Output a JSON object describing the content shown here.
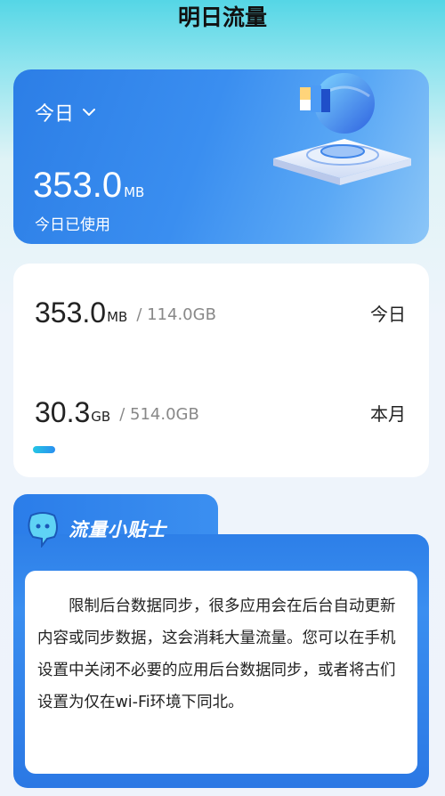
{
  "page": {
    "title": "明日流量"
  },
  "hero": {
    "period_label": "今日",
    "usage_value": "353.0",
    "usage_unit": "MB",
    "usage_caption": "今日已使用"
  },
  "stats": {
    "rows": [
      {
        "value": "353.0",
        "unit": "MB",
        "total": "/ 114.0GB",
        "label": "今日"
      },
      {
        "value": "30.3",
        "unit": "GB",
        "total": "/ 514.0GB",
        "label": "本月"
      }
    ],
    "progress_fraction": 0.06
  },
  "tips": {
    "title": "流量小贴士",
    "text": "限制后台数据同步，很多应用会在后台自动更新内容或同步数据，这会消耗大量流量。您可以在手机设置中关闭不必要的应用后台数据同步，或者将古们设置为仅在wi-Fi环境下同北。"
  },
  "colors": {
    "accent": "#2c7ee6",
    "progress_start": "#24c6e4",
    "progress_end": "#2a8ff0"
  }
}
